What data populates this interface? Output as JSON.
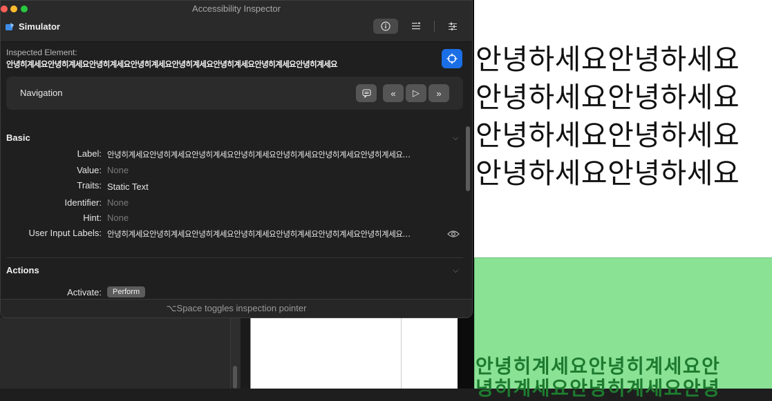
{
  "window": {
    "title": "Accessibility Inspector",
    "target": "Simulator",
    "toolbar": {
      "inspector_icon": "info-icon",
      "list_icon": "list-icon",
      "settings_icon": "sliders-icon"
    }
  },
  "inspected": {
    "label": "Inspected Element:",
    "value": "안녕히계세요안녕히계세요안녕히계세요안녕히계세요안녕히계세요안녕히계세요안녕히계세요안녕히계세요"
  },
  "navigation": {
    "label": "Navigation",
    "buttons": [
      "speech-icon",
      "previous-icon",
      "play-icon",
      "next-icon"
    ]
  },
  "basic": {
    "title": "Basic",
    "rows": [
      {
        "label": "Label:",
        "value": "안녕히계세요안녕히계세요안녕히계세요안녕히계세요안녕히계세요안녕히계세요안녕히계세요…"
      },
      {
        "label": "Value:",
        "value": "None"
      },
      {
        "label": "Traits:",
        "value": "Static Text"
      },
      {
        "label": "Identifier:",
        "value": "None"
      },
      {
        "label": "Hint:",
        "value": "None"
      },
      {
        "label": "User Input Labels:",
        "value": "안녕히계세요안녕히계세요안녕히계세요안녕히계세요안녕히계세요안녕히계세요안녕히계세요…"
      }
    ]
  },
  "actions": {
    "title": "Actions",
    "activate_label": "Activate:",
    "perform_label": "Perform"
  },
  "footer": "⌥Space toggles inspection pointer",
  "simulator": {
    "lines": [
      "안녕하세요안녕하세요",
      "안녕하세요안녕하세요",
      "안녕하세요안녕하세요",
      "안녕하세요안녕하세요"
    ],
    "green_lines": [
      "안녕히계세요안녕히계세요안",
      "녕히계세요안녕히계세요안녕"
    ]
  },
  "colors": {
    "accent": "#1a6ee6",
    "green_bg": "#8ae295",
    "green_text": "#1d7a2e"
  }
}
